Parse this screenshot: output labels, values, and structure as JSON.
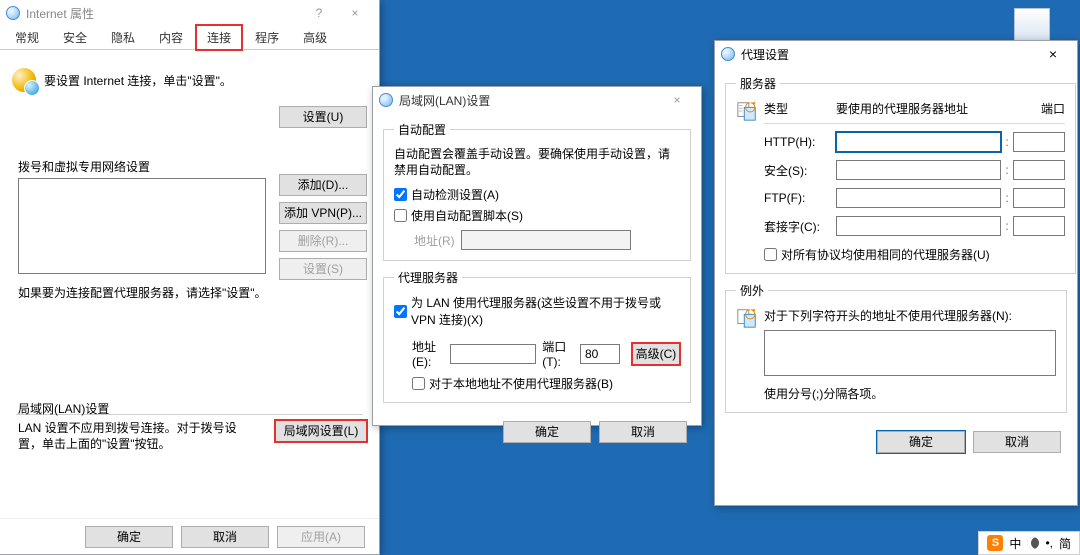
{
  "inet": {
    "title": "Internet 属性",
    "help": "?",
    "close": "×",
    "tabs": [
      "常规",
      "安全",
      "隐私",
      "内容",
      "连接",
      "程序",
      "高级"
    ],
    "active_tab_index": 4,
    "intro": "要设置 Internet 连接，单击\"设置\"。",
    "setup_btn": "设置(U)",
    "dial_section": "拨号和虚拟专用网络设置",
    "add_btn": "添加(D)...",
    "add_vpn_btn": "添加 VPN(P)...",
    "del_btn": "删除(R)...",
    "set_btn": "设置(S)",
    "dial_note": "如果要为连接配置代理服务器，请选择\"设置\"。",
    "lan_group": "局域网(LAN)设置",
    "lan_note": "LAN 设置不应用到拨号连接。对于拨号设置，单击上面的\"设置\"按钮。",
    "lan_btn": "局域网设置(L)",
    "ok": "确定",
    "cancel": "取消",
    "apply": "应用(A)"
  },
  "lan": {
    "title": "局域网(LAN)设置",
    "close": "×",
    "auto_group": "自动配置",
    "auto_note": "自动配置会覆盖手动设置。要确保使用手动设置，请禁用自动配置。",
    "auto_detect": "自动检测设置(A)",
    "use_script": "使用自动配置脚本(S)",
    "addr_label": "地址(R)",
    "proxy_group": "代理服务器",
    "use_proxy": "为 LAN 使用代理服务器(这些设置不用于拨号或 VPN 连接)(X)",
    "addr2_label": "地址(E):",
    "port_label": "端口(T):",
    "port_value": "80",
    "adv_btn": "高级(C)",
    "bypass_local": "对于本地地址不使用代理服务器(B)",
    "ok": "确定",
    "cancel": "取消"
  },
  "proxy": {
    "title": "代理设置",
    "close": "×",
    "srv_group": "服务器",
    "hdr_type": "类型",
    "hdr_addr": "要使用的代理服务器地址",
    "hdr_port": "端口",
    "rows": {
      "http": "HTTP(H):",
      "secure": "安全(S):",
      "ftp": "FTP(F):",
      "socks": "套接字(C):"
    },
    "same_all": "对所有协议均使用相同的代理服务器(U)",
    "ex_group": "例外",
    "ex_note": "对于下列字符开头的地址不使用代理服务器(N):",
    "ex_hint": "使用分号(;)分隔各项。",
    "ok": "确定",
    "cancel": "取消"
  },
  "ime": {
    "mode": "中",
    "extra": "简"
  }
}
